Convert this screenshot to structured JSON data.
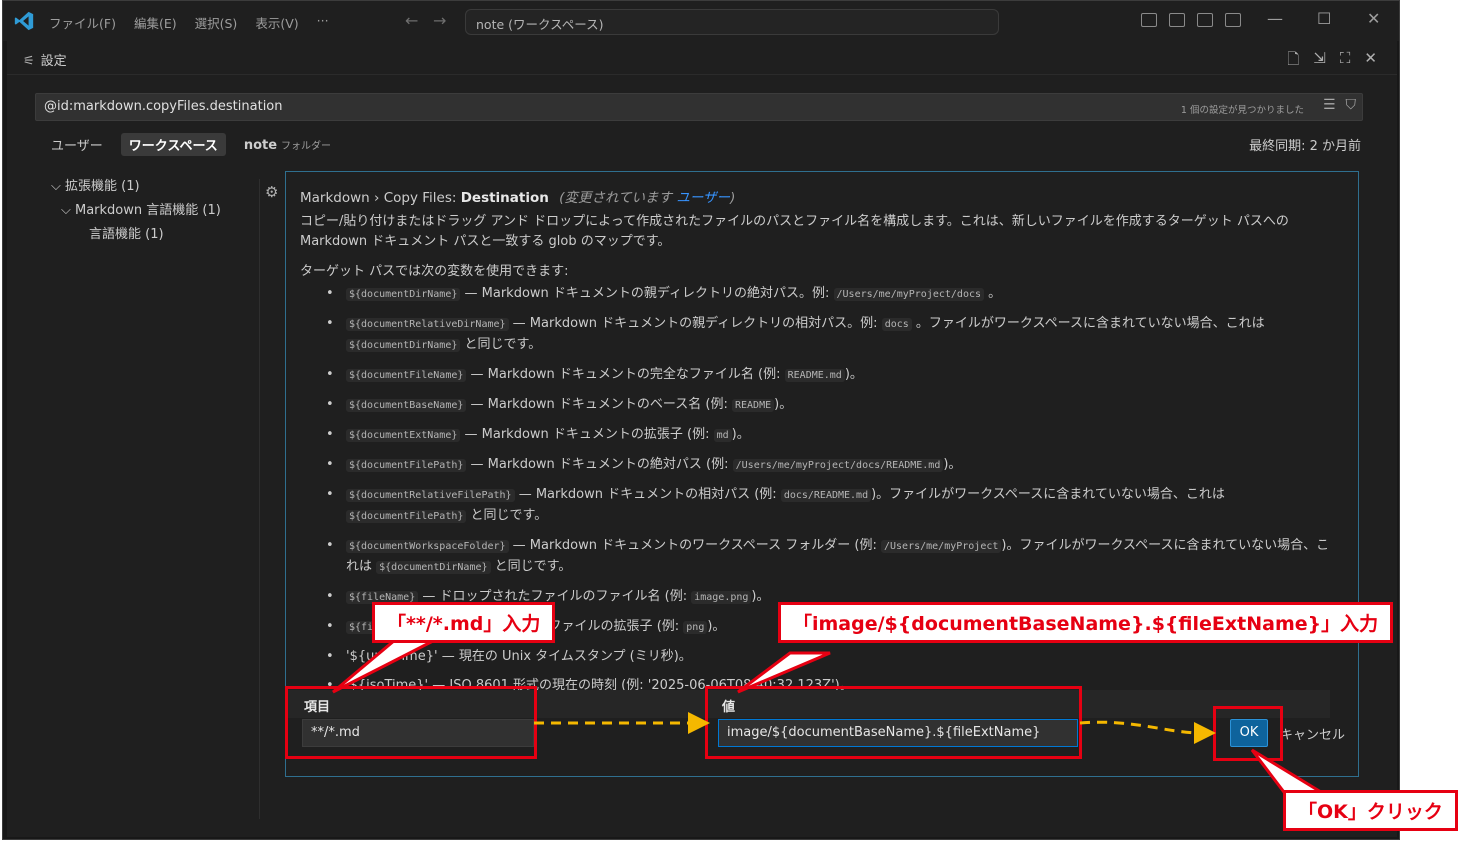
{
  "titlebar": {
    "menu": [
      "ファイル(F)",
      "編集(E)",
      "選択(S)",
      "表示(V)",
      "···"
    ],
    "search_text": "note (ワークスペース)",
    "minimize": "—",
    "maximize": "☐",
    "close": "✕"
  },
  "tab": {
    "title": "設定"
  },
  "search": {
    "value": "@id:markdown.copyFiles.destination",
    "found_text": "1 個の設定が見つかりました"
  },
  "scopes": {
    "user": "ユーザー",
    "workspace": "ワークスペース",
    "folder": "note",
    "folder_sub": "フォルダー"
  },
  "last_sync": "最終同期: 2 か月前",
  "tree": [
    {
      "label": "拡張機能 (1)"
    },
    {
      "label": "Markdown 言語機能 (1)"
    },
    {
      "label": "言語機能 (1)"
    }
  ],
  "setting": {
    "title_prefix": "Markdown › Copy Files: ",
    "title_name": "Destination",
    "modified_prefix": "(変更されています ",
    "modified_link": "ユーザー",
    "modified_suffix": ")",
    "description": "コピー/貼り付けまたはドラッグ アンド ドロップによって作成されたファイルのパスとファイル名を構成します。これは、新しいファイルを作成するターゲット パスへの Markdown ドキュメント パスと一致する glob のマップです。",
    "vars_heading": "ターゲット パスでは次の変数を使用できます:",
    "vars": [
      {
        "segments": [
          {
            "code": "${documentDirName}"
          },
          {
            "text": " — Markdown ドキュメントの親ディレクトリの絶対パス。例: "
          },
          {
            "code": "/Users/me/myProject/docs"
          },
          {
            "text": " 。"
          }
        ]
      },
      {
        "segments": [
          {
            "code": "${documentRelativeDirName}"
          },
          {
            "text": " — Markdown ドキュメントの親ディレクトリの相対パス。例: "
          },
          {
            "code": "docs"
          },
          {
            "text": " 。ファイルがワークスペースに含まれていない場合、これは "
          },
          {
            "code": "${documentDirName}"
          },
          {
            "text": " と同じです。"
          }
        ]
      },
      {
        "segments": [
          {
            "code": "${documentFileName}"
          },
          {
            "text": " — Markdown ドキュメントの完全なファイル名 (例: "
          },
          {
            "code": "README.md"
          },
          {
            "text": ")。"
          }
        ]
      },
      {
        "segments": [
          {
            "code": "${documentBaseName}"
          },
          {
            "text": " — Markdown ドキュメントのベース名 (例: "
          },
          {
            "code": "README"
          },
          {
            "text": ")。"
          }
        ]
      },
      {
        "segments": [
          {
            "code": "${documentExtName}"
          },
          {
            "text": " — Markdown ドキュメントの拡張子 (例: "
          },
          {
            "code": "md"
          },
          {
            "text": ")。"
          }
        ]
      },
      {
        "segments": [
          {
            "code": "${documentFilePath}"
          },
          {
            "text": " — Markdown ドキュメントの絶対パス (例: "
          },
          {
            "code": "/Users/me/myProject/docs/README.md"
          },
          {
            "text": ")。"
          }
        ]
      },
      {
        "segments": [
          {
            "code": "${documentRelativeFilePath}"
          },
          {
            "text": " — Markdown ドキュメントの相対パス (例: "
          },
          {
            "code": "docs/README.md"
          },
          {
            "text": ")。ファイルがワークスペースに含まれていない場合、これは "
          },
          {
            "code": "${documentFilePath}"
          },
          {
            "text": " と同じです。"
          }
        ]
      },
      {
        "segments": [
          {
            "code": "${documentWorkspaceFolder}"
          },
          {
            "text": " — Markdown ドキュメントのワークスペース フォルダー (例: "
          },
          {
            "code": "/Users/me/myProject"
          },
          {
            "text": ")。ファイルがワークスペースに含まれていない場合、これは "
          },
          {
            "code": "${documentDirName}"
          },
          {
            "text": " と同じです。"
          }
        ]
      },
      {
        "segments": [
          {
            "code": "${fileName}"
          },
          {
            "text": " — ドロップされたファイルのファイル名 (例: "
          },
          {
            "code": "image.png"
          },
          {
            "text": ")。"
          }
        ]
      },
      {
        "segments": [
          {
            "code": "${fileExtName}"
          },
          {
            "text": " — ドロップされたファイルの拡張子 (例: "
          },
          {
            "code": "png"
          },
          {
            "text": ")。"
          }
        ]
      },
      {
        "segments": [
          {
            "text": "'${unixTime}' — 現在の Unix タイムスタンプ (ミリ秒)。"
          }
        ]
      },
      {
        "segments": [
          {
            "text": "'${isoTime}' — ISO 8601 形式の現在の時刻 (例: '2025-06-06T08:40:32.123Z')。"
          }
        ]
      }
    ],
    "key_label": "項目",
    "value_label": "値",
    "key_value": "**/*.md",
    "value_value": "image/${documentBaseName}.${fileExtName}",
    "ok_label": "OK",
    "cancel_label": "キャンセル"
  },
  "annotations": {
    "key_callout": "「**/*.md」入力",
    "value_callout": "「image/${documentBaseName}.${fileExtName}」入力",
    "ok_callout": "「OK」クリック"
  },
  "colors": {
    "accent": "#0078d4",
    "ok_button": "#0e639c",
    "annotation_red": "#e60012",
    "arrow_yellow": "#f5b800"
  }
}
